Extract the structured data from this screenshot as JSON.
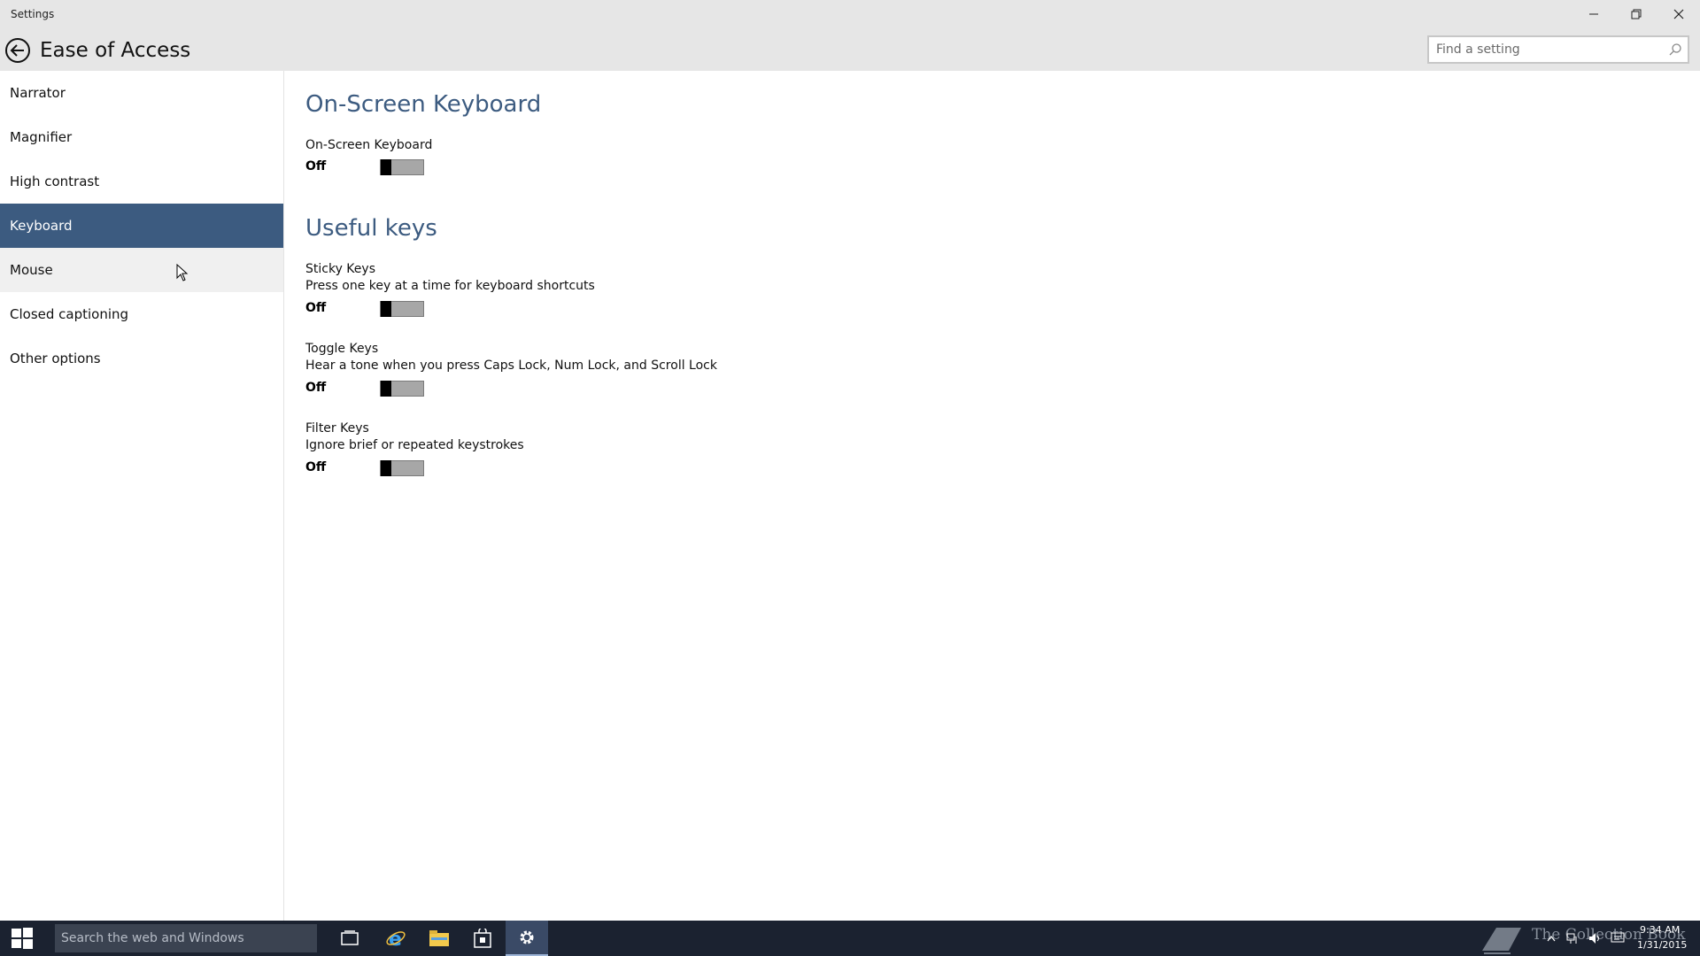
{
  "window": {
    "title": "Settings"
  },
  "header": {
    "title": "Ease of Access",
    "search_placeholder": "Find a setting"
  },
  "sidebar": {
    "items": [
      {
        "label": "Narrator"
      },
      {
        "label": "Magnifier"
      },
      {
        "label": "High contrast"
      },
      {
        "label": "Keyboard",
        "selected": true
      },
      {
        "label": "Mouse"
      },
      {
        "label": "Closed captioning"
      },
      {
        "label": "Other options"
      }
    ]
  },
  "content": {
    "osk_section": {
      "title": "On-Screen Keyboard",
      "setting_label": "On-Screen Keyboard",
      "state": "Off"
    },
    "useful_keys": {
      "title": "Useful keys",
      "sticky": {
        "label": "Sticky Keys",
        "desc": "Press one key at a time for keyboard shortcuts",
        "state": "Off"
      },
      "toggle": {
        "label": "Toggle Keys",
        "desc": "Hear a tone when you press Caps Lock, Num Lock, and Scroll Lock",
        "state": "Off"
      },
      "filter": {
        "label": "Filter Keys",
        "desc": "Ignore brief or repeated keystrokes",
        "state": "Off"
      }
    }
  },
  "taskbar": {
    "search_placeholder": "Search the web and Windows",
    "apps": [
      "task-view-icon",
      "internet-explorer-icon",
      "file-explorer-icon",
      "store-icon",
      "settings-icon"
    ],
    "watermark": "The Collection Book",
    "time": "9:34 AM",
    "date": "1/31/2015"
  },
  "colors": {
    "accent": "#3c5b80",
    "titlebar": "#e6e6e6",
    "taskbar": "#1b2230"
  }
}
